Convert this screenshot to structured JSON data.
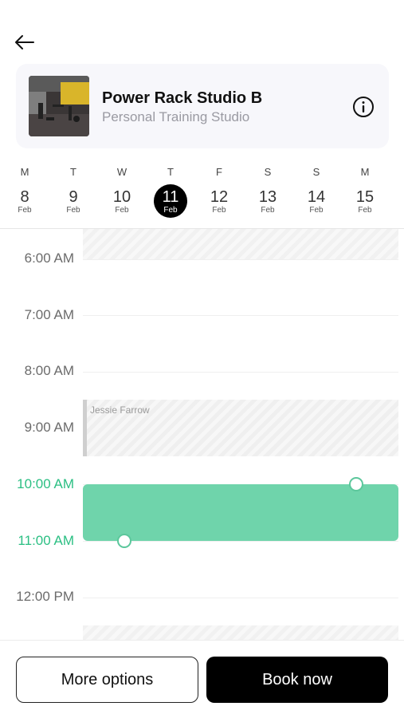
{
  "studio": {
    "name": "Power Rack Studio B",
    "type": "Personal Training Studio"
  },
  "week": {
    "days": [
      {
        "letter": "M",
        "num": "8",
        "month": "Feb",
        "selected": false
      },
      {
        "letter": "T",
        "num": "9",
        "month": "Feb",
        "selected": false
      },
      {
        "letter": "W",
        "num": "10",
        "month": "Feb",
        "selected": false
      },
      {
        "letter": "T",
        "num": "11",
        "month": "Feb",
        "selected": true
      },
      {
        "letter": "F",
        "num": "12",
        "month": "Feb",
        "selected": false
      },
      {
        "letter": "S",
        "num": "13",
        "month": "Feb",
        "selected": false
      },
      {
        "letter": "S",
        "num": "14",
        "month": "Feb",
        "selected": false
      },
      {
        "letter": "M",
        "num": "15",
        "month": "Feb",
        "selected": false
      }
    ]
  },
  "timeline": {
    "hours": [
      "6:00 AM",
      "7:00 AM",
      "8:00 AM",
      "9:00 AM",
      "10:00 AM",
      "11:00 AM",
      "12:00 PM"
    ],
    "active_hours": [
      "10:00 AM",
      "11:00 AM"
    ],
    "existing_booking": {
      "name": "Jessie Farrow"
    }
  },
  "colors": {
    "selection": "#6fd4ab",
    "active_time": "#2bbf83",
    "selected_day": "#000000"
  },
  "actions": {
    "more_options": "More options",
    "book_now": "Book now"
  }
}
